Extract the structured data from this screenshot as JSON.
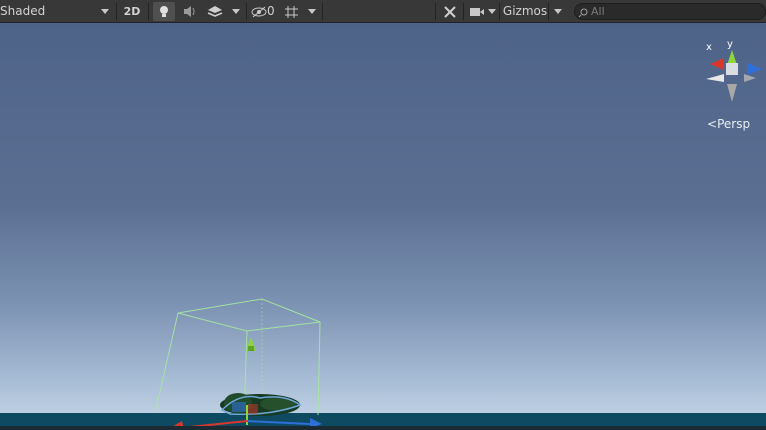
{
  "toolbar": {
    "shading_mode": "Shaded",
    "mode_2d": "2D",
    "effects_count": "0",
    "gizmos_label": "Gizmos",
    "search_placeholder": "All"
  },
  "scene_gizmo": {
    "axis_x": "x",
    "axis_y": "y",
    "projection_label": "Persp"
  },
  "colors": {
    "sky_top": "#4e6388",
    "sky_horizon": "#c8d8e8",
    "ground": "#0f4a63",
    "toolbar_bg": "#383838",
    "bounds_wire": "#a7e8a0",
    "axis_x": "#d8382c",
    "axis_y": "#8ed43b",
    "axis_z": "#2f6fd8"
  },
  "icons": [
    "dropdown-caret-icon",
    "lightbulb-icon",
    "audio-icon",
    "layers-icon",
    "visibility-icon",
    "grid-icon",
    "tools-icon",
    "camera-icon",
    "search-icon"
  ]
}
